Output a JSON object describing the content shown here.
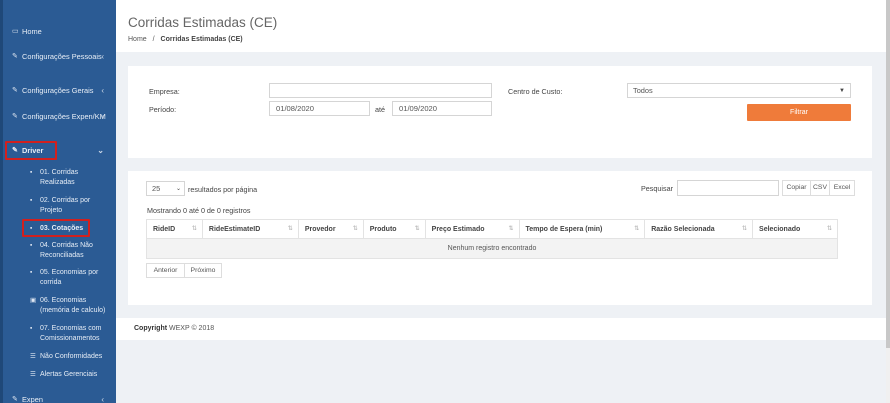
{
  "sidebar": {
    "items": [
      {
        "id": "home",
        "label": "Home",
        "icon": "monitor-icon"
      },
      {
        "id": "configuracoes-pessoais",
        "label": "Configurações Pessoais",
        "icon": "edit-icon"
      },
      {
        "id": "configuracoes-gerais",
        "label": "Configurações Gerais",
        "icon": "edit-icon"
      },
      {
        "id": "configuracoes-expen-km",
        "label": "Configurações Expen/KM",
        "icon": "edit-icon"
      },
      {
        "id": "driver",
        "label": "Driver",
        "icon": "edit-icon"
      },
      {
        "id": "expen",
        "label": "Expen",
        "icon": "edit-icon"
      }
    ],
    "driver_sub": [
      {
        "label": "01. Corridas Realizadas"
      },
      {
        "label": "02. Corridas por Projeto"
      },
      {
        "label": "03. Cotações"
      },
      {
        "label": "04. Corridas Não Reconciliadas"
      },
      {
        "label": "05. Economias por corrida"
      },
      {
        "label": "06. Economias (memória de calculo)"
      },
      {
        "label": "07. Economias com Comissionamentos"
      },
      {
        "label": "Não Conformidades"
      },
      {
        "label": "Alertas Gerenciais"
      }
    ]
  },
  "header": {
    "title": "Corridas Estimadas (CE)",
    "breadcrumb_home": "Home",
    "breadcrumb_sep": "/",
    "breadcrumb_current": "Corridas Estimadas (CE)"
  },
  "filters": {
    "empresa_label": "Empresa:",
    "empresa_value": "",
    "periodo_label": "Período:",
    "date_from": "01/08/2020",
    "ate_label": "até",
    "date_to": "01/09/2020",
    "centro_label": "Centro de Custo:",
    "centro_value": "Todos",
    "filter_button": "Filtrar"
  },
  "table": {
    "page_length": "25",
    "page_length_label": "resultados por página",
    "search_label": "Pesquisar",
    "search_value": "",
    "export_buttons": [
      "Copiar",
      "CSV",
      "Excel"
    ],
    "info": "Mostrando 0 até 0 de 0 registros",
    "columns": [
      "RideID",
      "RideEstimateID",
      "Provedor",
      "Produto",
      "Preço Estimado",
      "Tempo de Espera (min)",
      "Razão Selecionada",
      "Selecionado"
    ],
    "empty_text": "Nenhum registro encontrado",
    "prev": "Anterior",
    "next": "Próximo"
  },
  "footer": {
    "copyright_label": "Copyright",
    "copyright_rest": "WEXP © 2018"
  },
  "colors": {
    "sidebar": "#2b5b94",
    "accent": "#ef7b3a",
    "highlight": "#d2201e"
  }
}
